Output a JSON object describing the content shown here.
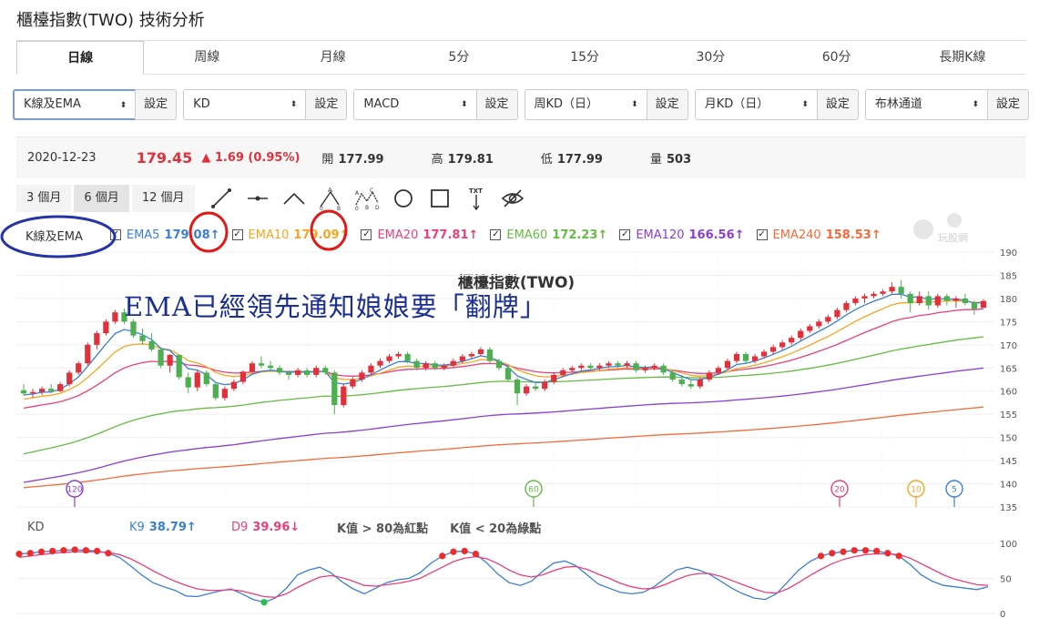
{
  "page_title": "櫃檯指數(TWO) 技術分析",
  "tabs": [
    "日線",
    "周線",
    "月線",
    "5分",
    "15分",
    "30分",
    "60分",
    "長期K線"
  ],
  "selectors": [
    {
      "value": "K線及EMA",
      "button": "設定"
    },
    {
      "value": "KD",
      "button": "設定"
    },
    {
      "value": "MACD",
      "button": "設定"
    },
    {
      "value": "周KD（日）",
      "button": "設定"
    },
    {
      "value": "月KD（日）",
      "button": "設定"
    },
    {
      "value": "布林通道",
      "button": "設定"
    }
  ],
  "quote": {
    "date": "2020-12-23",
    "price": "179.45",
    "change": "▲ 1.69 (0.95%)",
    "open_label": "開",
    "open": "177.99",
    "high_label": "高",
    "high": "179.81",
    "low_label": "低",
    "low": "177.99",
    "volume_label": "量",
    "volume": "503"
  },
  "ranges": [
    "3 個月",
    "6 個月",
    "12 個月"
  ],
  "tools": [
    "line-tool-icon",
    "horizontal-line-tool-icon",
    "angle-tool-icon",
    "abc-pattern-tool-icon",
    "abcd-pattern-tool-icon",
    "circle-tool-icon",
    "rectangle-tool-icon",
    "text-tool-icon",
    "hide-drawings-icon"
  ],
  "ema_legend": {
    "title": "K線及EMA",
    "items": [
      {
        "name": "EMA5",
        "value": "179.08↑",
        "color": "#3a7fd5"
      },
      {
        "name": "EMA10",
        "value": "179.09↑",
        "color": "#f5a623"
      },
      {
        "name": "EMA20",
        "value": "177.81↑",
        "color": "#e8407c"
      },
      {
        "name": "EMA60",
        "value": "172.23↑",
        "color": "#66bb44"
      },
      {
        "name": "EMA120",
        "value": "166.56↑",
        "color": "#8a3fd1"
      },
      {
        "name": "EMA240",
        "value": "158.53↑",
        "color": "#f26b3a"
      }
    ]
  },
  "watermark_text": "玩股網",
  "annotation_text": "EMA已經領先通知娘娘要「翻牌」",
  "kd_legend": {
    "title": "KD",
    "k_label": "K9",
    "k_value": "38.79↑",
    "d_label": "D9",
    "d_value": "39.96↓",
    "note1": "K值 > 80為紅點",
    "note2": "K值 < 20為綠點"
  },
  "colors": {
    "up": "#e0313b",
    "down": "#4caf50",
    "k_line": "#3a7fd5",
    "d_line": "#e8407c",
    "highlight_circle": "#e01919",
    "legend_circle": "#2634a8"
  },
  "chart_data": [
    {
      "type": "candlestick",
      "title": "櫃檯指數(TWO)",
      "ylim": [
        135,
        190
      ],
      "y_ticks": [
        135,
        140,
        145,
        150,
        155,
        160,
        165,
        170,
        175,
        180,
        185,
        190
      ],
      "grid": true,
      "ema_markers": [
        {
          "label": "120",
          "color": "#8a3fd1"
        },
        {
          "label": "60",
          "color": "#66bb44"
        },
        {
          "label": "20",
          "color": "#e8407c"
        },
        {
          "label": "10",
          "color": "#f5a623"
        },
        {
          "label": "5",
          "color": "#3a7fd5"
        }
      ],
      "candles": [
        {
          "o": 160.2,
          "h": 161.5,
          "l": 159.0,
          "c": 159.5
        },
        {
          "o": 159.5,
          "h": 160.5,
          "l": 158.5,
          "c": 159.8
        },
        {
          "o": 159.8,
          "h": 161.0,
          "l": 159.2,
          "c": 160.5
        },
        {
          "o": 160.5,
          "h": 161.5,
          "l": 159.5,
          "c": 160.0
        },
        {
          "o": 160.0,
          "h": 162.0,
          "l": 159.8,
          "c": 161.5
        },
        {
          "o": 161.5,
          "h": 164.5,
          "l": 161.0,
          "c": 164.0
        },
        {
          "o": 164.0,
          "h": 166.5,
          "l": 163.5,
          "c": 166.0
        },
        {
          "o": 166.0,
          "h": 170.5,
          "l": 165.5,
          "c": 170.0
        },
        {
          "o": 170.0,
          "h": 173.0,
          "l": 169.0,
          "c": 172.5
        },
        {
          "o": 172.5,
          "h": 175.5,
          "l": 172.0,
          "c": 175.0
        },
        {
          "o": 175.0,
          "h": 177.5,
          "l": 174.5,
          "c": 177.0
        },
        {
          "o": 177.0,
          "h": 177.8,
          "l": 174.5,
          "c": 175.0
        },
        {
          "o": 175.0,
          "h": 175.5,
          "l": 171.5,
          "c": 172.0
        },
        {
          "o": 172.0,
          "h": 173.5,
          "l": 170.0,
          "c": 170.8
        },
        {
          "o": 170.8,
          "h": 172.5,
          "l": 168.5,
          "c": 169.0
        },
        {
          "o": 169.0,
          "h": 169.5,
          "l": 165.0,
          "c": 165.5
        },
        {
          "o": 165.5,
          "h": 168.0,
          "l": 164.0,
          "c": 167.8
        },
        {
          "o": 167.8,
          "h": 168.0,
          "l": 162.5,
          "c": 163.0
        },
        {
          "o": 163.0,
          "h": 164.0,
          "l": 159.5,
          "c": 160.8
        },
        {
          "o": 160.8,
          "h": 164.5,
          "l": 160.0,
          "c": 164.0
        },
        {
          "o": 164.0,
          "h": 164.5,
          "l": 161.0,
          "c": 161.5
        },
        {
          "o": 161.5,
          "h": 162.0,
          "l": 158.0,
          "c": 158.5
        },
        {
          "o": 158.5,
          "h": 161.0,
          "l": 158.0,
          "c": 160.5
        },
        {
          "o": 160.5,
          "h": 162.5,
          "l": 160.0,
          "c": 162.0
        },
        {
          "o": 162.0,
          "h": 164.5,
          "l": 161.5,
          "c": 164.2
        },
        {
          "o": 164.2,
          "h": 166.5,
          "l": 164.0,
          "c": 166.0
        },
        {
          "o": 166.0,
          "h": 167.5,
          "l": 165.0,
          "c": 165.5
        },
        {
          "o": 165.5,
          "h": 166.5,
          "l": 164.5,
          "c": 165.0
        },
        {
          "o": 165.0,
          "h": 165.5,
          "l": 163.5,
          "c": 164.0
        },
        {
          "o": 164.0,
          "h": 164.5,
          "l": 162.5,
          "c": 163.5
        },
        {
          "o": 163.5,
          "h": 165.0,
          "l": 163.0,
          "c": 164.5
        },
        {
          "o": 164.5,
          "h": 165.0,
          "l": 163.0,
          "c": 163.5
        },
        {
          "o": 163.5,
          "h": 165.5,
          "l": 163.0,
          "c": 165.0
        },
        {
          "o": 165.0,
          "h": 165.5,
          "l": 163.5,
          "c": 164.0
        },
        {
          "o": 164.0,
          "h": 164.5,
          "l": 155.0,
          "c": 157.0
        },
        {
          "o": 157.0,
          "h": 161.5,
          "l": 156.5,
          "c": 161.0
        },
        {
          "o": 161.0,
          "h": 163.0,
          "l": 160.5,
          "c": 162.5
        },
        {
          "o": 162.5,
          "h": 164.5,
          "l": 162.0,
          "c": 164.0
        },
        {
          "o": 164.0,
          "h": 166.0,
          "l": 163.5,
          "c": 165.5
        },
        {
          "o": 165.5,
          "h": 167.0,
          "l": 165.0,
          "c": 166.5
        },
        {
          "o": 166.5,
          "h": 168.0,
          "l": 166.0,
          "c": 167.5
        },
        {
          "o": 167.5,
          "h": 168.5,
          "l": 167.0,
          "c": 168.0
        },
        {
          "o": 168.0,
          "h": 168.5,
          "l": 166.0,
          "c": 166.5
        },
        {
          "o": 166.5,
          "h": 167.0,
          "l": 164.5,
          "c": 165.0
        },
        {
          "o": 165.0,
          "h": 166.5,
          "l": 164.5,
          "c": 166.0
        },
        {
          "o": 166.0,
          "h": 166.5,
          "l": 164.5,
          "c": 165.0
        },
        {
          "o": 165.0,
          "h": 166.0,
          "l": 164.5,
          "c": 165.5
        },
        {
          "o": 165.5,
          "h": 167.0,
          "l": 165.0,
          "c": 166.5
        },
        {
          "o": 166.5,
          "h": 168.0,
          "l": 166.0,
          "c": 167.5
        },
        {
          "o": 167.5,
          "h": 168.5,
          "l": 167.0,
          "c": 168.0
        },
        {
          "o": 168.0,
          "h": 169.5,
          "l": 167.5,
          "c": 169.0
        },
        {
          "o": 169.0,
          "h": 169.5,
          "l": 166.0,
          "c": 166.5
        },
        {
          "o": 166.5,
          "h": 167.0,
          "l": 164.5,
          "c": 165.0
        },
        {
          "o": 165.0,
          "h": 165.5,
          "l": 162.0,
          "c": 162.5
        },
        {
          "o": 162.5,
          "h": 163.0,
          "l": 157.0,
          "c": 159.5
        },
        {
          "o": 159.5,
          "h": 161.5,
          "l": 159.0,
          "c": 161.0
        },
        {
          "o": 161.0,
          "h": 162.0,
          "l": 160.0,
          "c": 160.5
        },
        {
          "o": 160.5,
          "h": 162.5,
          "l": 160.0,
          "c": 162.0
        },
        {
          "o": 162.0,
          "h": 164.0,
          "l": 161.5,
          "c": 163.5
        },
        {
          "o": 163.5,
          "h": 165.0,
          "l": 163.0,
          "c": 164.5
        },
        {
          "o": 164.5,
          "h": 165.5,
          "l": 164.0,
          "c": 165.0
        },
        {
          "o": 165.0,
          "h": 166.0,
          "l": 164.5,
          "c": 165.5
        },
        {
          "o": 165.5,
          "h": 166.0,
          "l": 164.5,
          "c": 165.0
        },
        {
          "o": 165.0,
          "h": 166.0,
          "l": 164.5,
          "c": 165.5
        },
        {
          "o": 165.5,
          "h": 166.5,
          "l": 165.0,
          "c": 166.0
        },
        {
          "o": 166.0,
          "h": 166.5,
          "l": 165.0,
          "c": 165.5
        },
        {
          "o": 165.5,
          "h": 166.5,
          "l": 165.0,
          "c": 166.0
        },
        {
          "o": 166.0,
          "h": 166.5,
          "l": 164.0,
          "c": 164.5
        },
        {
          "o": 164.5,
          "h": 165.5,
          "l": 164.0,
          "c": 165.0
        },
        {
          "o": 165.0,
          "h": 166.0,
          "l": 164.5,
          "c": 165.5
        },
        {
          "o": 165.5,
          "h": 166.0,
          "l": 163.5,
          "c": 164.0
        },
        {
          "o": 164.0,
          "h": 164.5,
          "l": 162.0,
          "c": 162.5
        },
        {
          "o": 162.5,
          "h": 163.5,
          "l": 161.0,
          "c": 161.5
        },
        {
          "o": 161.5,
          "h": 162.5,
          "l": 160.5,
          "c": 161.0
        },
        {
          "o": 161.0,
          "h": 163.0,
          "l": 160.5,
          "c": 162.5
        },
        {
          "o": 162.5,
          "h": 164.5,
          "l": 162.0,
          "c": 164.0
        },
        {
          "o": 164.0,
          "h": 165.5,
          "l": 163.5,
          "c": 165.0
        },
        {
          "o": 165.0,
          "h": 167.0,
          "l": 164.5,
          "c": 166.5
        },
        {
          "o": 166.5,
          "h": 168.5,
          "l": 166.0,
          "c": 168.0
        },
        {
          "o": 168.0,
          "h": 168.5,
          "l": 166.0,
          "c": 166.5
        },
        {
          "o": 166.5,
          "h": 168.0,
          "l": 166.0,
          "c": 167.5
        },
        {
          "o": 167.5,
          "h": 169.0,
          "l": 167.0,
          "c": 168.5
        },
        {
          "o": 168.5,
          "h": 170.0,
          "l": 168.0,
          "c": 169.5
        },
        {
          "o": 169.5,
          "h": 171.0,
          "l": 169.0,
          "c": 170.5
        },
        {
          "o": 170.5,
          "h": 172.0,
          "l": 170.0,
          "c": 171.5
        },
        {
          "o": 171.5,
          "h": 173.5,
          "l": 171.0,
          "c": 173.0
        },
        {
          "o": 173.0,
          "h": 174.5,
          "l": 172.5,
          "c": 174.0
        },
        {
          "o": 174.0,
          "h": 175.5,
          "l": 173.5,
          "c": 175.0
        },
        {
          "o": 175.0,
          "h": 176.5,
          "l": 174.5,
          "c": 176.0
        },
        {
          "o": 176.0,
          "h": 178.0,
          "l": 175.5,
          "c": 177.5
        },
        {
          "o": 177.5,
          "h": 179.5,
          "l": 177.0,
          "c": 179.0
        },
        {
          "o": 179.0,
          "h": 180.5,
          "l": 178.5,
          "c": 180.0
        },
        {
          "o": 180.0,
          "h": 181.0,
          "l": 179.0,
          "c": 180.5
        },
        {
          "o": 180.5,
          "h": 181.5,
          "l": 180.0,
          "c": 181.0
        },
        {
          "o": 181.0,
          "h": 182.0,
          "l": 180.5,
          "c": 181.5
        },
        {
          "o": 181.5,
          "h": 183.5,
          "l": 181.0,
          "c": 182.5
        },
        {
          "o": 182.5,
          "h": 184.0,
          "l": 180.0,
          "c": 181.0
        },
        {
          "o": 181.0,
          "h": 181.5,
          "l": 177.0,
          "c": 179.0
        },
        {
          "o": 179.0,
          "h": 181.5,
          "l": 178.5,
          "c": 180.5
        },
        {
          "o": 180.5,
          "h": 181.5,
          "l": 177.5,
          "c": 178.5
        },
        {
          "o": 178.5,
          "h": 181.0,
          "l": 178.0,
          "c": 180.5
        },
        {
          "o": 180.5,
          "h": 181.0,
          "l": 178.5,
          "c": 179.5
        },
        {
          "o": 179.5,
          "h": 180.5,
          "l": 178.0,
          "c": 180.0
        },
        {
          "o": 180.0,
          "h": 181.0,
          "l": 178.5,
          "c": 179.0
        },
        {
          "o": 179.0,
          "h": 179.5,
          "l": 176.5,
          "c": 177.76
        },
        {
          "o": 177.99,
          "h": 179.81,
          "l": 177.99,
          "c": 179.45
        }
      ]
    },
    {
      "type": "line",
      "title": "KD",
      "ylim": [
        0,
        100
      ],
      "y_ticks": [
        0,
        50,
        100
      ],
      "series": [
        {
          "name": "K9",
          "values": [
            85,
            86,
            88,
            89,
            90,
            91,
            90,
            89,
            86,
            80,
            68,
            55,
            44,
            38,
            33,
            25,
            24,
            28,
            32,
            35,
            28,
            20,
            16,
            22,
            36,
            55,
            62,
            66,
            58,
            45,
            35,
            28,
            36,
            44,
            48,
            50,
            58,
            72,
            82,
            88,
            89,
            85,
            72,
            56,
            44,
            40,
            46,
            60,
            72,
            75,
            68,
            55,
            42,
            36,
            30,
            28,
            30,
            38,
            50,
            62,
            66,
            62,
            56,
            46,
            36,
            28,
            22,
            20,
            28,
            45,
            62,
            74,
            82,
            86,
            88,
            90,
            90,
            89,
            86,
            82,
            70,
            55,
            46,
            40,
            38,
            36,
            34,
            38
          ]
        },
        {
          "name": "D9",
          "values": [
            80,
            82,
            84,
            86,
            87,
            88,
            88,
            88,
            87,
            84,
            78,
            70,
            61,
            53,
            46,
            40,
            35,
            33,
            33,
            34,
            32,
            28,
            24,
            23,
            28,
            37,
            45,
            52,
            54,
            51,
            46,
            40,
            39,
            41,
            43,
            46,
            50,
            58,
            66,
            74,
            79,
            81,
            78,
            71,
            62,
            55,
            52,
            55,
            61,
            66,
            67,
            63,
            56,
            50,
            43,
            38,
            35,
            36,
            41,
            48,
            54,
            57,
            57,
            53,
            47,
            41,
            35,
            30,
            29,
            35,
            44,
            54,
            63,
            71,
            77,
            81,
            84,
            85,
            85,
            84,
            79,
            71,
            63,
            55,
            49,
            45,
            41,
            40
          ]
        }
      ],
      "red_dot_rule": "K值 > 80為紅點",
      "green_dot_rule": "K值 < 20為綠點"
    }
  ]
}
